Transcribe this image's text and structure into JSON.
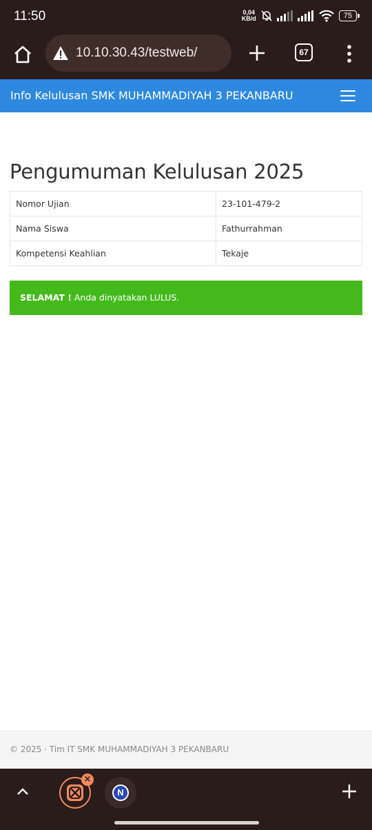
{
  "status_bar": {
    "time": "11:50",
    "net_speed_value": "0,04",
    "net_speed_unit": "KB/d",
    "battery": "75"
  },
  "browser": {
    "url": "10.10.30.43/testweb/",
    "tab_count": "67"
  },
  "navbar": {
    "brand": "Info Kelulusan SMK MUHAMMADIYAH 3 PEKANBARU"
  },
  "main": {
    "title": "Pengumuman Kelulusan 2025",
    "rows": [
      {
        "label": "Nomor Ujian",
        "value": "23-101-479-2"
      },
      {
        "label": "Nama Siswa",
        "value": "Fathurrahman"
      },
      {
        "label": "Kompetensi Keahlian",
        "value": "Tekaje"
      }
    ],
    "alert_strong": "SELAMAT !",
    "alert_text": " Anda dinyatakan LULUS."
  },
  "footer": {
    "text": "© 2025 · Tim IT SMK MUHAMMADIYAH 3 PEKANBARU"
  },
  "bottom_bar": {
    "tab2_letter": "N"
  },
  "colors": {
    "navbar": "#2e88e0",
    "alert_success": "#43b91c",
    "chrome": "#2a1c1a"
  }
}
